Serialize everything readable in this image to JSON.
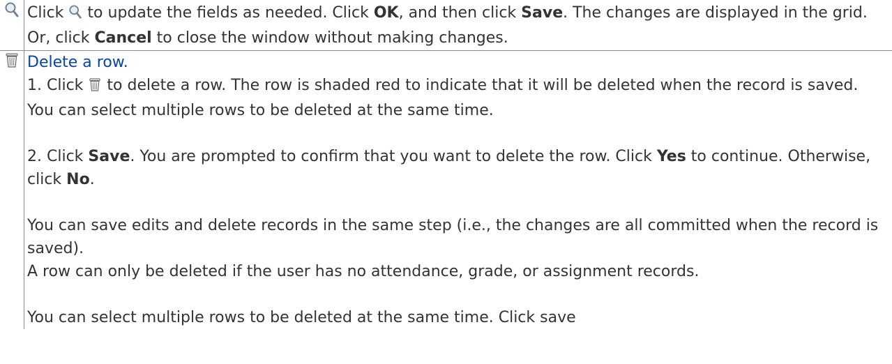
{
  "rows": [
    {
      "icon": "magnifier-icon",
      "text": {
        "p1_a": "Click ",
        "p1_b": " to update the fields as needed. Click ",
        "ok": "OK",
        "p1_c": ", and then click ",
        "save": "Save",
        "p1_d": ". The changes are displayed in the grid. Or, click ",
        "cancel": "Cancel",
        "p1_e": " to close the window without making changes."
      }
    },
    {
      "icon": "trash-icon",
      "link": "Delete a row.",
      "step1": {
        "a": "1. Click ",
        "b": " to delete a row. The row is shaded red to indicate that it will be deleted when the record is saved. You can select multiple rows to be deleted at the same time."
      },
      "step2": {
        "a": "2. Click ",
        "save": "Save",
        "b": ". You are prompted to confirm that you want to delete the row. Click ",
        "yes": "Yes",
        "c": " to continue. Otherwise, click ",
        "no": "No",
        "d": "."
      },
      "note1": "You can save edits and delete records in the same step (i.e., the changes are all committed when the record is saved).",
      "note2": "A row can only be deleted if the user has no attendance, grade, or assignment records.",
      "note3": "You can select multiple rows to be deleted at the same time. Click save"
    }
  ],
  "colors": {
    "link": "#0645ad",
    "text": "#333333",
    "border": "#8a8a8a"
  }
}
